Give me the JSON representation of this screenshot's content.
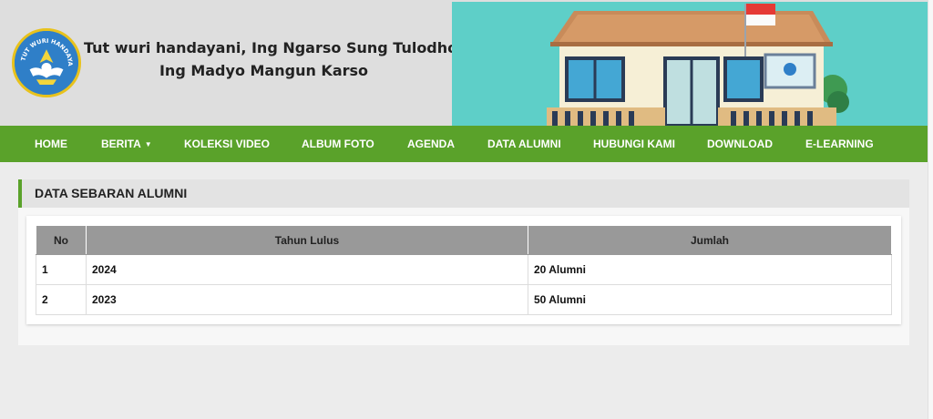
{
  "header": {
    "motto_line1": "Tut wuri handayani, Ing Ngarso Sung Tulodho",
    "motto_line2": "Ing Madyo Mangun Karso",
    "logo_text": "TUT WURI HANDAYANI"
  },
  "nav": {
    "items": [
      {
        "label": "HOME"
      },
      {
        "label": "BERITA",
        "caret": "▼"
      },
      {
        "label": "KOLEKSI VIDEO"
      },
      {
        "label": "ALBUM FOTO"
      },
      {
        "label": "AGENDA"
      },
      {
        "label": "DATA ALUMNI"
      },
      {
        "label": "HUBUNGI KAMI"
      },
      {
        "label": "DOWNLOAD"
      },
      {
        "label": "E-LEARNING"
      }
    ]
  },
  "section": {
    "title": "DATA SEBARAN ALUMNI",
    "table": {
      "headers": [
        "No",
        "Tahun Lulus",
        "Jumlah"
      ],
      "rows": [
        [
          "1",
          "2024",
          "20 Alumni"
        ],
        [
          "2",
          "2023",
          "50 Alumni"
        ]
      ]
    }
  },
  "colors": {
    "nav_green": "#5aa22a",
    "hero_teal": "#5ecfc8",
    "table_header": "#999999",
    "logo_blue": "#2f7fc8",
    "logo_gold": "#e8c21c"
  },
  "icons": {
    "logo": "tut-wuri-handayani-emblem",
    "hero": "school-building-illustration",
    "dropdown": "caret-down-icon"
  }
}
